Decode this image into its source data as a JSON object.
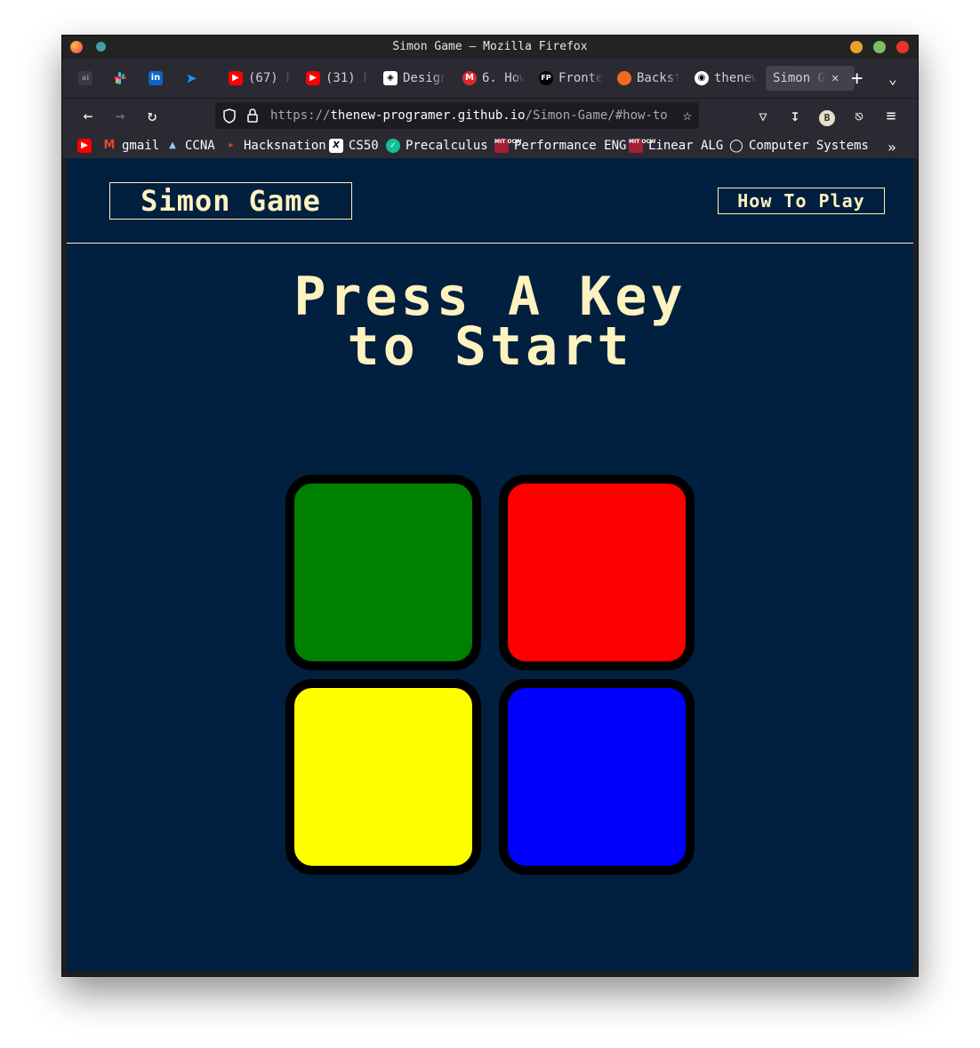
{
  "window": {
    "title": "Simon Game — Mozilla Firefox",
    "controls_colors": {
      "minimize": "#e5a22d",
      "maximize": "#7cbd68",
      "close": "#e5352d"
    }
  },
  "tabs": [
    {
      "icon": "generic-site-icon",
      "label": ""
    },
    {
      "icon": "slack-icon",
      "label": ""
    },
    {
      "icon": "linkedin-icon",
      "label": ""
    },
    {
      "icon": "twitter-icon",
      "label": ""
    },
    {
      "icon": "youtube-icon",
      "label": "(67) F"
    },
    {
      "icon": "youtube-icon",
      "label": "(31) F"
    },
    {
      "icon": "design-icon",
      "label": "Design"
    },
    {
      "icon": "m-icon",
      "label": "6. How"
    },
    {
      "icon": "fp-icon",
      "label": "Fronte"
    },
    {
      "icon": "backstage-icon",
      "label": "Backst"
    },
    {
      "icon": "github-icon",
      "label": "thenew"
    },
    {
      "icon": "none",
      "label": "Simon G"
    }
  ],
  "url": {
    "prefix": "https://",
    "host": "thenew-programer.github.io",
    "path": "/Simon-Game/#how-to"
  },
  "bookmarks": [
    {
      "icon": "youtube-icon",
      "label": ""
    },
    {
      "icon": "gmail-icon",
      "label": "gmail"
    },
    {
      "icon": "cisco-icon",
      "label": "CCNA"
    },
    {
      "icon": "hacksnation-icon",
      "label": "Hacksnation"
    },
    {
      "icon": "x-icon",
      "label": "CS50"
    },
    {
      "icon": "khan-icon",
      "label": "Precalculus"
    },
    {
      "icon": "mit-ocw-icon",
      "label": "Performance ENG"
    },
    {
      "icon": "mit-ocw-icon",
      "label": "Linear ALG"
    },
    {
      "icon": "globe-icon",
      "label": "Computer Systems"
    }
  ],
  "page": {
    "logo": "Simon Game",
    "how_to_play": "How To Play",
    "level_title_line1": "Press A Key",
    "level_title_line2": "to Start",
    "background": "#011f3f",
    "accent": "#fef2bf",
    "buttons": [
      {
        "name": "green",
        "color": "#008000"
      },
      {
        "name": "red",
        "color": "#ff0000"
      },
      {
        "name": "yellow",
        "color": "#ffff00"
      },
      {
        "name": "blue",
        "color": "#0000ff"
      }
    ]
  }
}
